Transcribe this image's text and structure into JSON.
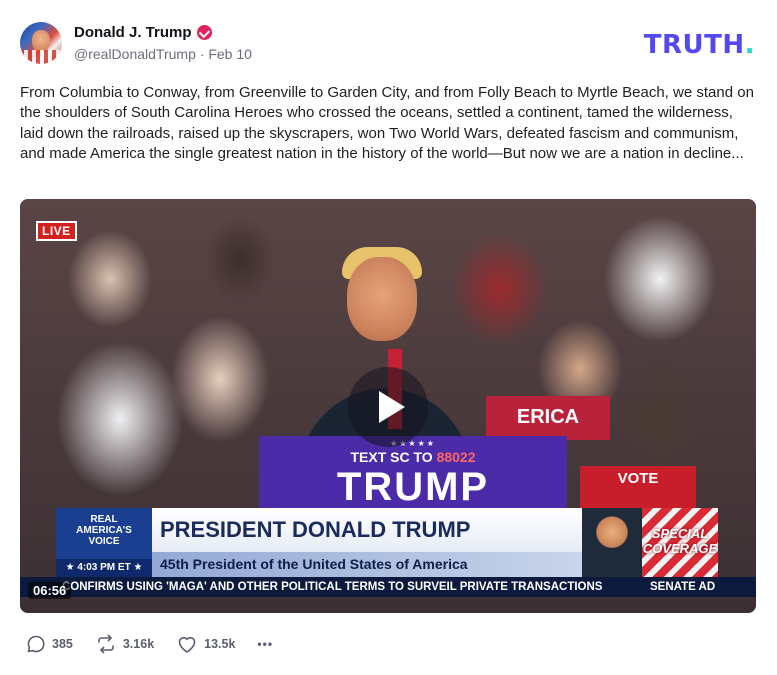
{
  "author": {
    "display_name": "Donald J. Trump",
    "handle": "@realDonaldTrump",
    "separator": "·",
    "date": "Feb 10"
  },
  "brand": {
    "name": "TRUTH",
    "dot": "."
  },
  "post": {
    "text": "From Columbia to Conway, from Greenville to Garden City, and from Folly Beach to Myrtle Beach, we stand on the shoulders of South Carolina Heroes who crossed the oceans, settled a continent, tamed the wilderness, laid down the railroads, raised up the skyscrapers, won Two World Wars, defeated fascism and communism, and made America the single greatest nation in the history of the world—But now we are a nation in decline..."
  },
  "video": {
    "live_badge": "LIVE",
    "duration": "06:56",
    "podium": {
      "stars": "★★★★★",
      "text_prefix": "TEXT SC TO",
      "text_number": "88022",
      "big": "TRUMP"
    },
    "signs": {
      "right_top": "ERICA",
      "right_bottom": "VOTE"
    },
    "lower_third": {
      "network_line1": "REAL",
      "network_line2": "AMERICA'S",
      "network_line3": "VOICE",
      "time": "★ 4:03 PM ET ★",
      "headline": "PRESIDENT DONALD TRUMP",
      "subheadline": "45th President of the United States of America",
      "special": "SPECIAL COVERAGE"
    },
    "ticker": {
      "main": "CONFIRMS USING 'MAGA' AND OTHER POLITICAL TERMS TO SURVEIL PRIVATE TRANSACTIONS",
      "right": "SENATE AD"
    }
  },
  "actions": {
    "replies": "385",
    "retruths": "3.16k",
    "likes": "13.5k",
    "more": "•••"
  },
  "colors": {
    "brand_purple": "#5448ee",
    "brand_teal": "#17e1c0",
    "verified": "#e0245e",
    "text_secondary": "#6b6f7a"
  }
}
